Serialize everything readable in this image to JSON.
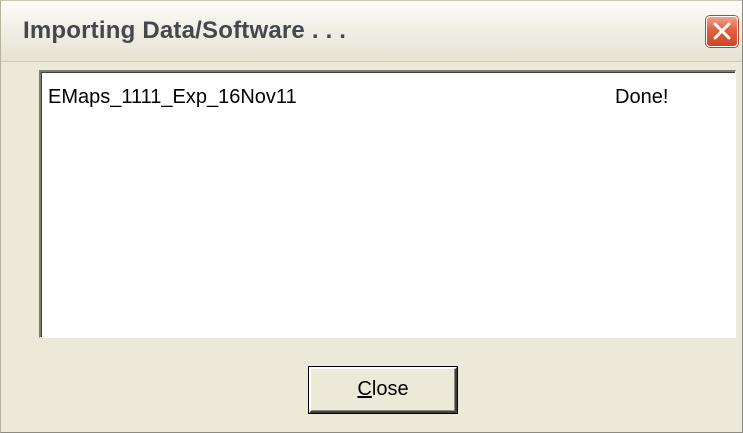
{
  "window": {
    "title": "Importing Data/Software . . .",
    "close_icon": "close-x-icon"
  },
  "list": {
    "items": [
      {
        "name": "EMaps_1111_Exp_16Nov11",
        "status": "Done!"
      }
    ]
  },
  "buttons": {
    "close_mnemonic": "C",
    "close_rest": "lose"
  },
  "colors": {
    "dialog_bg": "#ece9d8",
    "close_icon_bg": "#e0603f"
  }
}
